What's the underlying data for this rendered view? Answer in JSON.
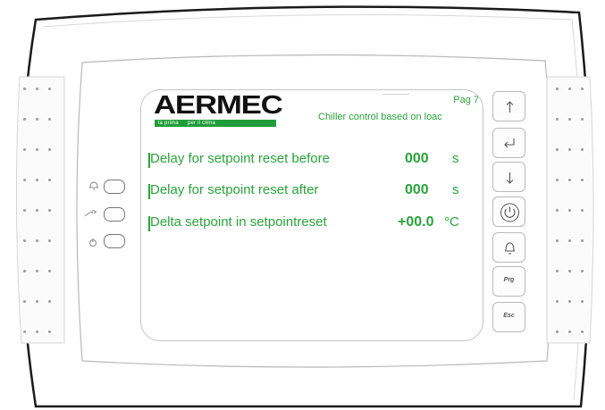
{
  "brand": {
    "name": "AERMEC",
    "slogan_part1": "la prima",
    "slogan_part2": "per il clima",
    "brand_color": "#1f9d3a"
  },
  "screen": {
    "page_label": "Pag 7",
    "subtitle": "Chiller control based on loac",
    "text_color": "#2aa33c",
    "rows": [
      {
        "label": "Delay for setpoint reset before",
        "value": "000",
        "unit": "s"
      },
      {
        "label": "Delay for setpoint reset after",
        "value": "000",
        "unit": "s"
      },
      {
        "label": "Delta setpoint in setpointreset",
        "value": "+00.0",
        "unit": "°C"
      }
    ]
  },
  "keypad": [
    {
      "name": "up-arrow-key",
      "icon": "arrow-up-icon",
      "label": ""
    },
    {
      "name": "enter-key",
      "icon": "enter-icon",
      "label": ""
    },
    {
      "name": "down-arrow-key",
      "icon": "arrow-down-icon",
      "label": ""
    },
    {
      "name": "power-key",
      "icon": "power-icon",
      "label": ""
    },
    {
      "name": "alarm-key",
      "icon": "bell-icon",
      "label": ""
    },
    {
      "name": "prg-key",
      "icon": "",
      "label": "Prg"
    },
    {
      "name": "esc-key",
      "icon": "",
      "label": "Esc"
    }
  ],
  "indicators": [
    {
      "name": "alarm-led",
      "icon": "bell-icon"
    },
    {
      "name": "service-led",
      "icon": "wrench-icon"
    },
    {
      "name": "power-led",
      "icon": "power-icon"
    }
  ]
}
